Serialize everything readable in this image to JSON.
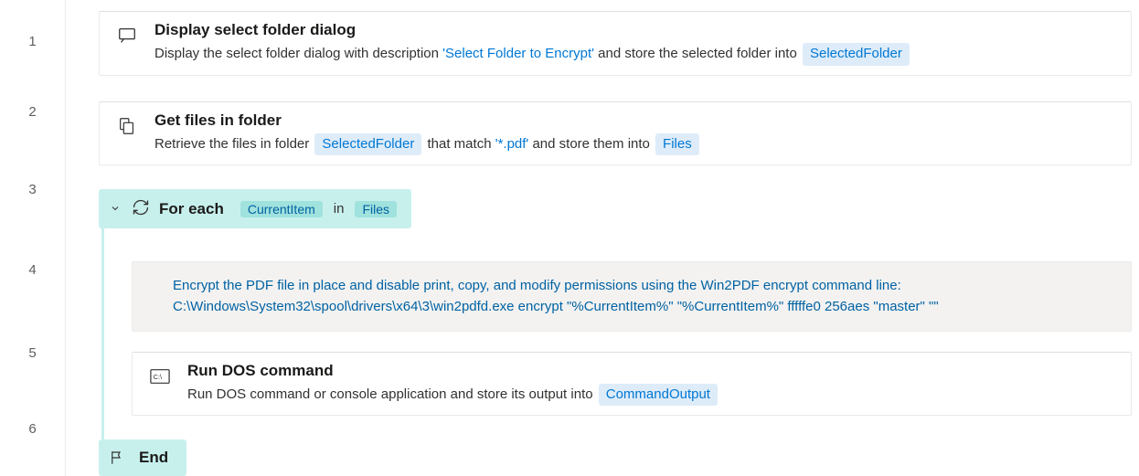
{
  "steps": [
    {
      "title": "Display select folder dialog",
      "desc_pre": "Display the select folder dialog with description ",
      "str1": "'Select Folder to Encrypt'",
      "desc_mid": " and store the selected folder into ",
      "var1": "SelectedFolder"
    },
    {
      "title": "Get files in folder",
      "desc_pre": "Retrieve the files in folder ",
      "var1": "SelectedFolder",
      "desc_mid": " that match ",
      "str1": "'*.pdf'",
      "desc_post": " and store them into ",
      "var2": "Files"
    }
  ],
  "loop": {
    "title": "For each",
    "var1": "CurrentItem",
    "word": "in",
    "var2": "Files",
    "end": "End"
  },
  "comment": {
    "line1": "Encrypt the PDF file in place  and disable print, copy, and modify permissions using the Win2PDF encrypt command line:",
    "line2": "C:\\Windows\\System32\\spool\\drivers\\x64\\3\\win2pdfd.exe encrypt \"%CurrentItem%\" \"%CurrentItem%\" fffffe0 256aes \"master\" \"\""
  },
  "run": {
    "title": "Run DOS command",
    "desc_pre": "Run DOS command or console application and store its output into ",
    "var1": "CommandOutput"
  },
  "line_nums": {
    "l1": "1",
    "l2": "2",
    "l3": "3",
    "l4": "4",
    "l5": "5",
    "l6": "6"
  }
}
